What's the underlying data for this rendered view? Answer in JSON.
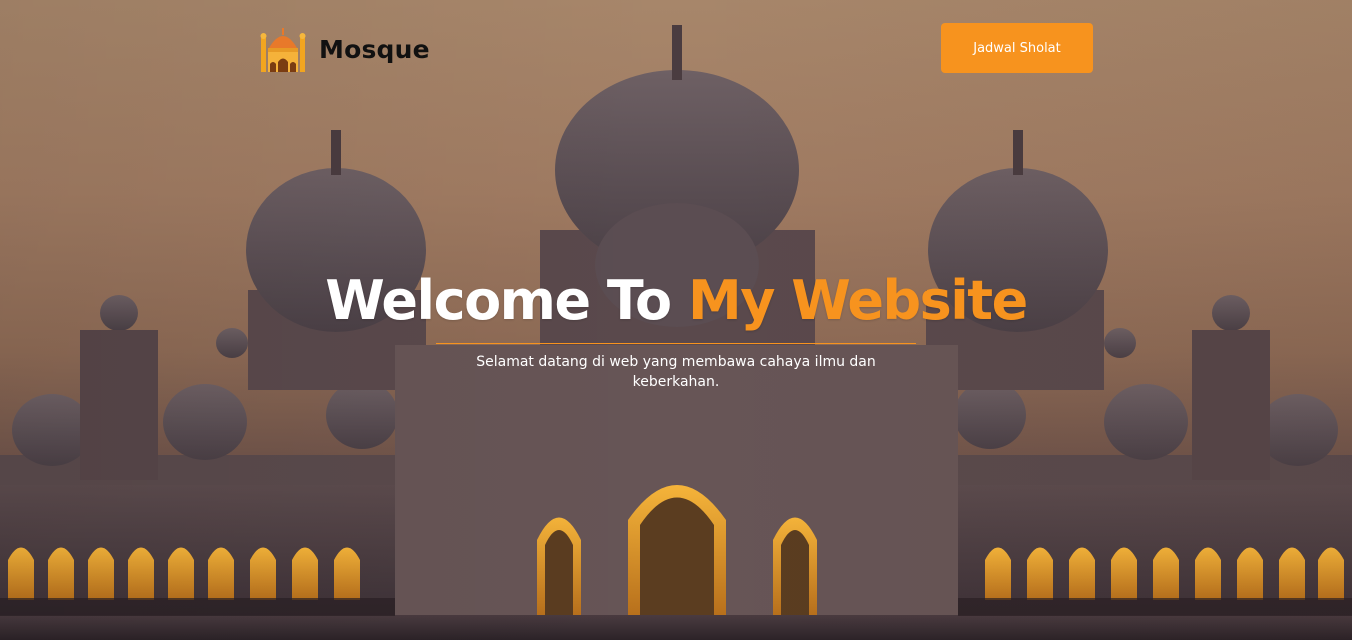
{
  "brand": {
    "name": "Mosque",
    "logo_icon": "mosque-icon"
  },
  "nav": {
    "button_label": "Jadwal Sholat"
  },
  "hero": {
    "title_part1": "Welcome To",
    "title_part2": "My Website",
    "subtitle": "Selamat datang di web yang membawa cahaya ilmu dan keberkahan."
  },
  "colors": {
    "accent": "#f7931e",
    "brand_text": "#111111",
    "hero_text": "#ffffff"
  }
}
